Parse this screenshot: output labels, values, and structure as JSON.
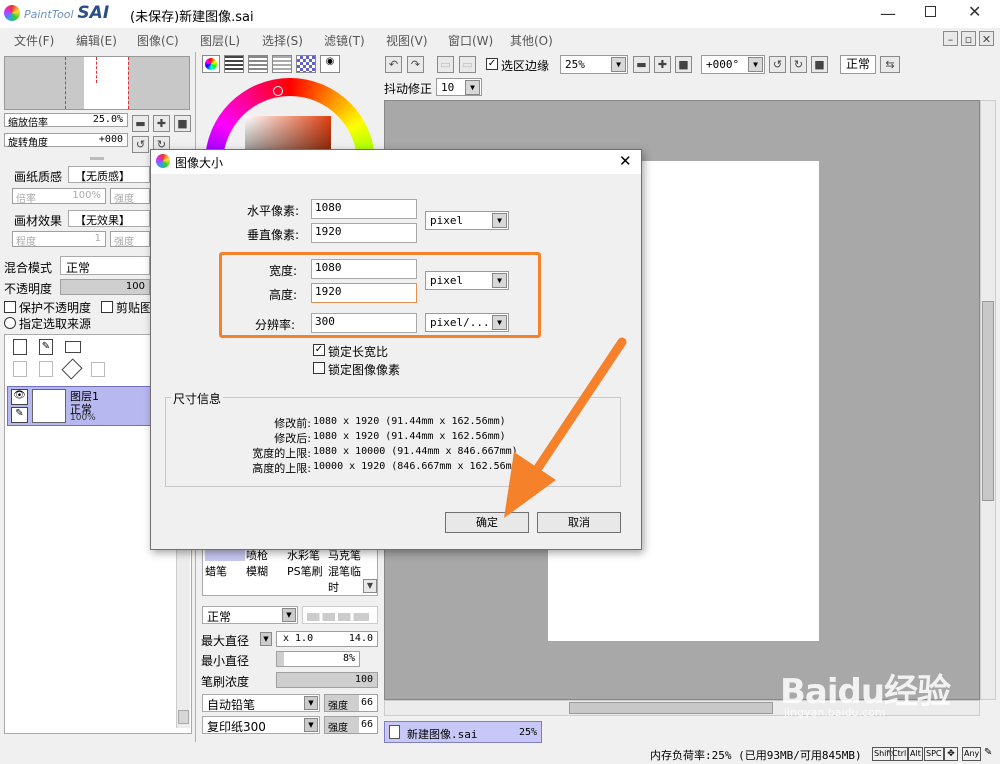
{
  "window": {
    "app_name": "PaintTool SAI",
    "title": "(未保存)新建图像.sai"
  },
  "menu": [
    "文件(F)",
    "编辑(E)",
    "图像(C)",
    "图层(L)",
    "选择(S)",
    "滤镜(T)",
    "视图(V)",
    "窗口(W)",
    "其他(O)"
  ],
  "navigator": {
    "zoom_label": "缩放倍率",
    "zoom_value": "25.0%",
    "rotate_label": "旋转角度",
    "rotate_value": "+000"
  },
  "layer_props": {
    "paper_texture_label": "画纸质感",
    "paper_texture_value": "【无质感】",
    "rate_label": "倍率",
    "rate_value": "100%",
    "strength_label": "强度",
    "paper_effect_label": "画材效果",
    "paper_effect_value": "【无效果】",
    "degree_label": "程度",
    "degree_value": "1",
    "strength2_label": "强度",
    "blend_label": "混合模式",
    "blend_value": "正常",
    "opacity_label": "不透明度",
    "opacity_value": "100",
    "protect_opacity": "保护不透明度",
    "clipping": "剪贴图",
    "selection_source": "指定选取来源"
  },
  "layer": {
    "name": "图层1",
    "mode": "正常",
    "opacity": "100%"
  },
  "toolbar": {
    "selection_edge": "选区边缘",
    "zoom": "25%",
    "rotation": "+000°",
    "mode": "正常",
    "stabilizer_label": "抖动修正",
    "stabilizer_value": "10"
  },
  "dialog": {
    "title": "图像大小",
    "width_px_label": "水平像素:",
    "width_px": "1080",
    "height_px_label": "垂直像素:",
    "height_px": "1920",
    "unit_px": "pixel",
    "width_label": "宽度:",
    "width": "1080",
    "height_label": "高度:",
    "height": "1920",
    "unit": "pixel",
    "resolution_label": "分辨率:",
    "resolution": "300",
    "resolution_unit": "pixel/...",
    "lock_aspect": "锁定长宽比",
    "lock_pixels": "锁定图像像素",
    "info_title": "尺寸信息",
    "info": [
      {
        "label": "修改前:",
        "value": "1080 x 1920 (91.44mm x 162.56mm)"
      },
      {
        "label": "修改后:",
        "value": "1080 x 1920 (91.44mm x 162.56mm)"
      },
      {
        "label": "宽度的上限:",
        "value": "1080 x 10000 (91.44mm x 846.667mm)"
      },
      {
        "label": "高度的上限:",
        "value": "10000 x 1920 (846.667mm x 162.56mm)"
      }
    ],
    "ok": "确定",
    "cancel": "取消"
  },
  "brushes": {
    "row1": [
      "",
      "喷枪",
      "水彩笔",
      "马克笔"
    ],
    "row2": [
      "蜡笔",
      "模糊",
      "PS笔刷",
      "混笔临时"
    ]
  },
  "brush_settings": {
    "mode": "正常",
    "max_size_label": "最大直径",
    "max_size_mult": "x 1.0",
    "max_size_value": "14.0",
    "min_size_label": "最小直径",
    "min_size_value": "8%",
    "density_label": "笔刷浓度",
    "density_value": "100",
    "shape": "自动铅笔",
    "shape_strength_label": "强度",
    "shape_strength": "66",
    "texture": "复印纸300",
    "texture_strength_label": "强度",
    "texture_strength": "66"
  },
  "doc_tab": {
    "name": "新建图像.sai",
    "zoom": "25%"
  },
  "status": {
    "memory": "内存负荷率:25% (已用93MB/可用845MB)",
    "keys": [
      "Shift",
      "Ctrl",
      "Alt",
      "SPC",
      "Any"
    ]
  },
  "watermark": {
    "brand": "Baidu经验",
    "url": "jingyan.baidu.com"
  },
  "colors": {
    "accent_orange": "#f5822a",
    "layer_selected": "#b8b8f0"
  }
}
